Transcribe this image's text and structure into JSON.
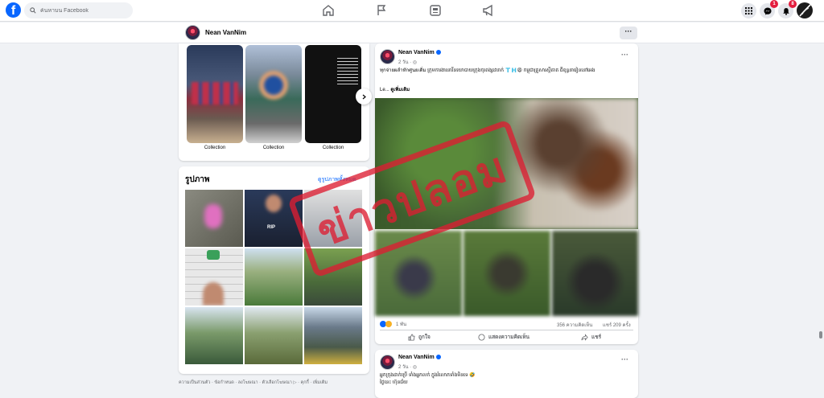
{
  "topbar": {
    "search_placeholder": "ค้นหาบน Facebook",
    "messenger_badge": "1",
    "notifications_badge": "8"
  },
  "profile_header": {
    "name": "Nean VanNim",
    "more_label": "···"
  },
  "collections": {
    "items": [
      {
        "label": "Collection"
      },
      {
        "label": "Collection"
      },
      {
        "label": "Collection"
      }
    ]
  },
  "photos": {
    "title": "รูปภาพ",
    "see_all": "ดูรูปภาพทั้งหมด",
    "rip_label": "RIP"
  },
  "footer": {
    "text": "ความเป็นส่วนตัว · ข้อกำหนด · ลงโฆษณา · ตัวเลือกโฆษณา ▷ · คุกกี้ · เพิ่มเติม"
  },
  "post1": {
    "author": "Nean VanNim",
    "time": "2 วัน · ◎",
    "more_label": "···",
    "text": "ทุกจ่ายผลำหักศูนยเดิ่ม ក្រុមការងារនារីនយោបាយក្រុងចុរពង្សដារាក់ 🇹🇭😩 កម្ពុជាគ្រួសារស្ដីគាត ធីឌុន្ធនារៀននៅអេង",
    "read_more_prefix": "Le... ",
    "read_more": "ดูเพิ่มเติม",
    "stamp": "ข่าวปลอม",
    "reactions": "1 พัน",
    "comments": "356 ความคิดเห็น",
    "shares": "แชร์ 209 ครั้ง",
    "like_label": "ถูกใจ",
    "comment_label": "แสดงความคิดเห็น",
    "share_label": "แชร์"
  },
  "post2": {
    "author": "Nean VanNim",
    "time": "2 วัน · ◎",
    "more_label": "···",
    "text_line1": "អ្នកក្រុងដាក់ប្រើ ទាំងអ្នកលក់ ក្នុងរំលោភទាំងមិនទេ 🤣",
    "text_line2": "ថ្ងៃនេះ ហ៊ុនជ័យ"
  },
  "colors": {
    "brand": "#0866ff",
    "stamp_red": "#dc1e32",
    "background": "#f0f2f5"
  }
}
